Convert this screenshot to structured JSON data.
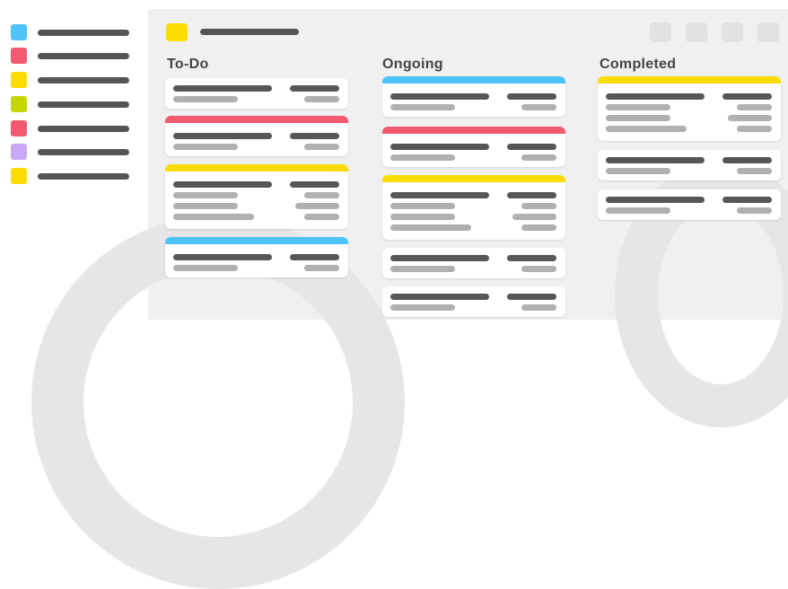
{
  "colors": {
    "blue": "#4dc3f7",
    "red": "#f25a70",
    "yellow": "#fadc00",
    "green": "#c6d600",
    "purple": "#c9a8f5"
  },
  "sidebar": {
    "items": [
      {
        "color": "#4dc3f7"
      },
      {
        "color": "#f25a70"
      },
      {
        "color": "#fadc00"
      },
      {
        "color": "#c6d600"
      },
      {
        "color": "#f25a70"
      },
      {
        "color": "#c9a8f5"
      },
      {
        "color": "#fadc00"
      }
    ]
  },
  "board": {
    "icon_color": "#fadc00",
    "columns": [
      {
        "title": "To-Do"
      },
      {
        "title": "Ongoing"
      },
      {
        "title": "Completed"
      }
    ]
  }
}
